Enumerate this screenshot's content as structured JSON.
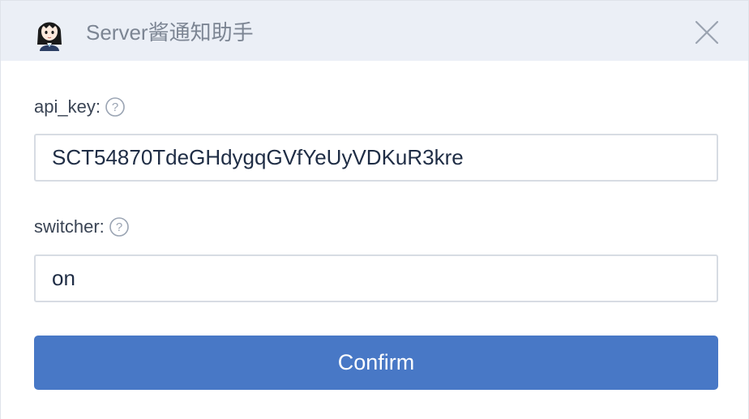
{
  "window": {
    "title": "Server酱通知助手",
    "avatar_icon": "girl-avatar-icon",
    "close_icon": "close-icon"
  },
  "form": {
    "api_key": {
      "label": "api_key:",
      "help_icon": "question-circle-icon",
      "value": "SCT54870TdeGHdygqGVfYeUyVDKuR3kre"
    },
    "switcher": {
      "label": "switcher:",
      "help_icon": "question-circle-icon",
      "value": "on"
    },
    "confirm_label": "Confirm"
  },
  "colors": {
    "titlebar_bg": "#ebeff6",
    "title_text": "#7c8593",
    "button_bg": "#4878c6",
    "input_border": "#d7dce3",
    "help_icon": "#9aa4b3"
  }
}
